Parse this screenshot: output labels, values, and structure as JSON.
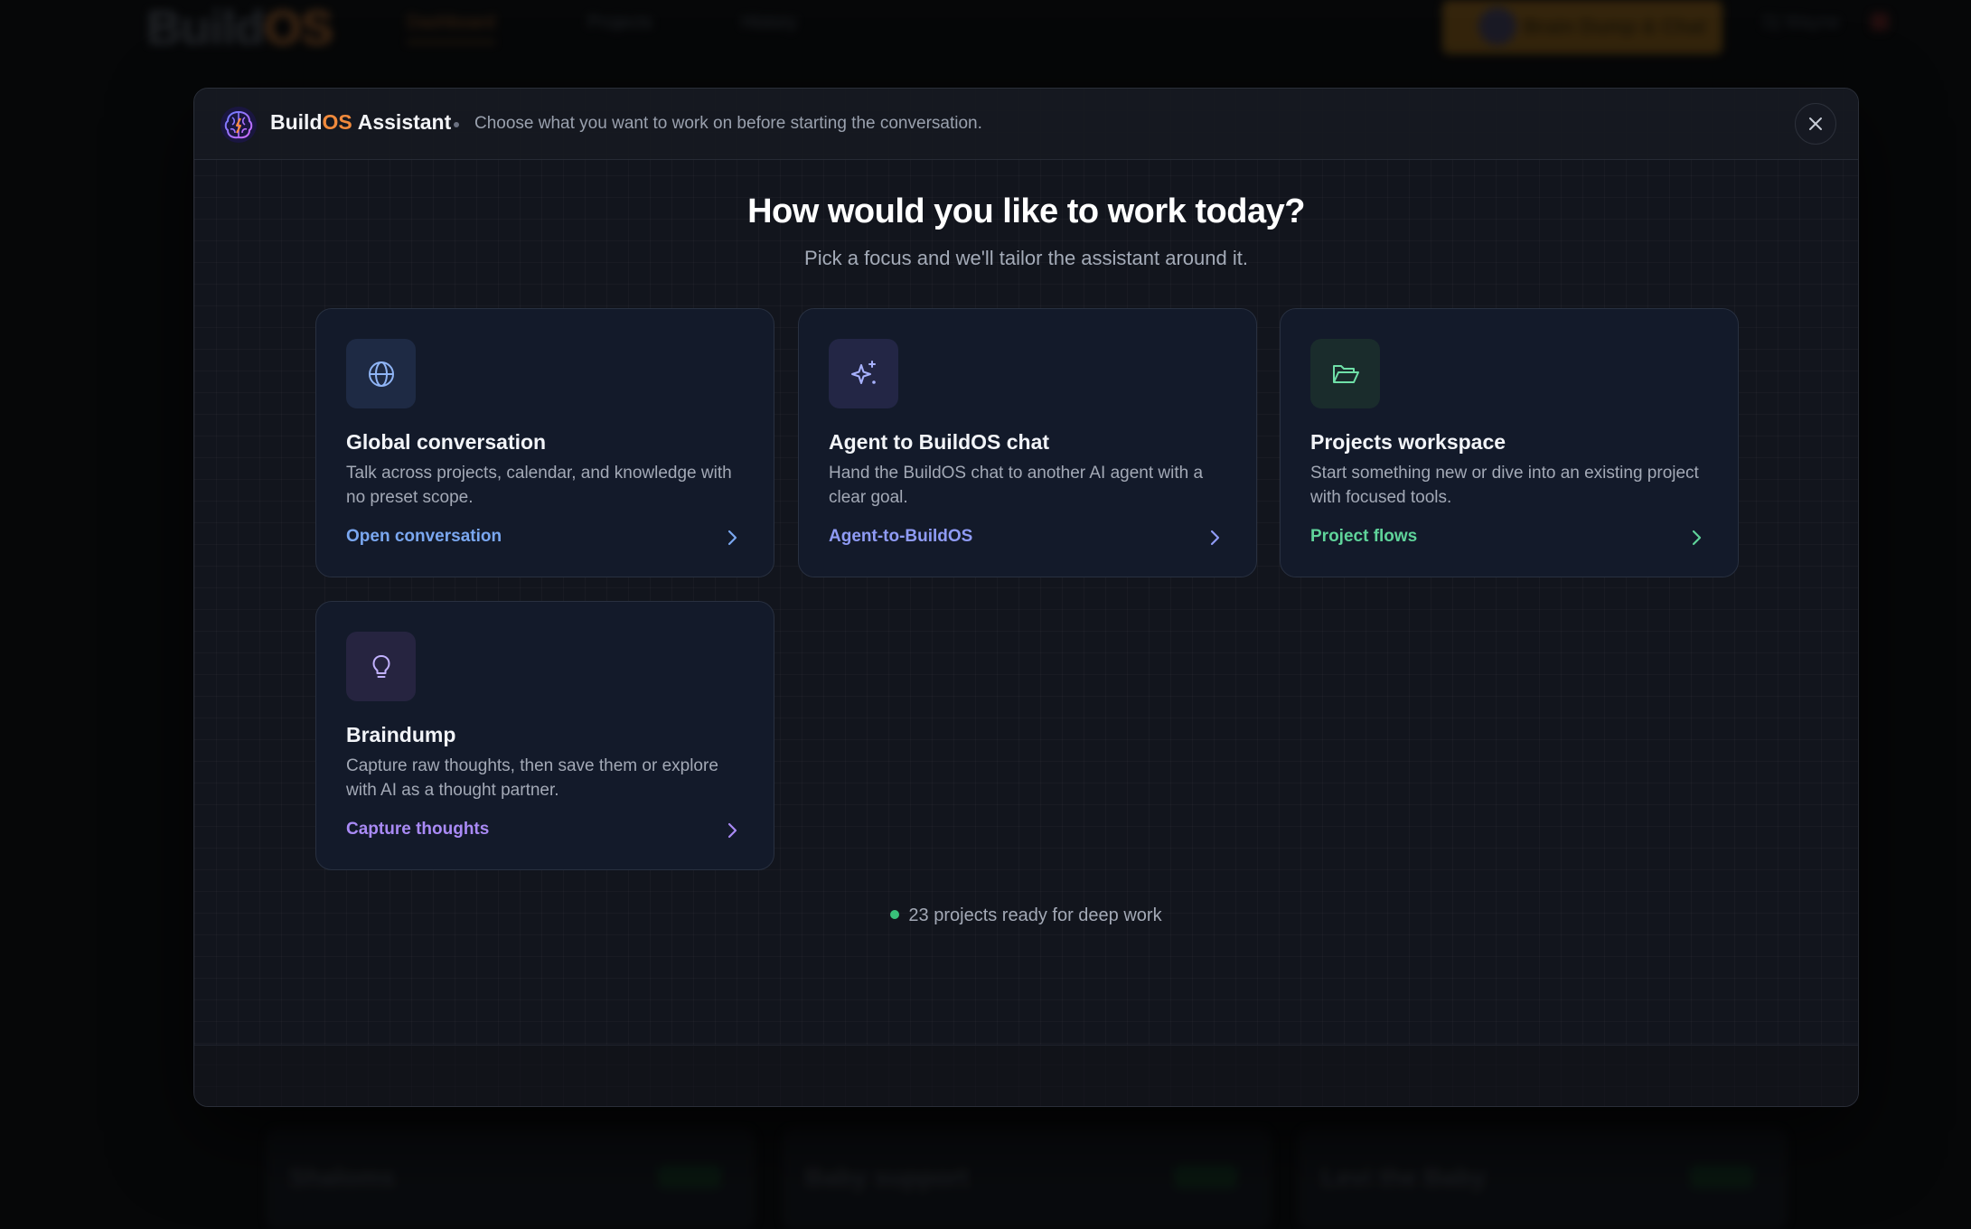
{
  "background": {
    "logo_build": "Build",
    "logo_os": "OS",
    "nav_items": [
      "Dashboard",
      "Projects",
      "History"
    ],
    "cta_label": "Brain Dump & Chat",
    "user_label": "Dj Wayne",
    "cards": [
      {
        "title": "Shaloms",
        "badge": "Active"
      },
      {
        "title": "Baby support",
        "badge": "Active"
      },
      {
        "title": "Levi the Baby",
        "badge": "Active"
      }
    ]
  },
  "modal": {
    "brand_build": "Build",
    "brand_os": "OS",
    "brand_assistant": "Assistant",
    "header_subtitle": "Choose what you want to work on before starting the conversation.",
    "close_icon": "close-icon",
    "title": "How would you like to work today?",
    "subtitle": "Pick a focus and we'll tailor the assistant around it.",
    "options": [
      {
        "icon": "globe-icon",
        "title": "Global conversation",
        "description": "Talk across projects, calendar, and knowledge with no preset scope.",
        "link": "Open conversation",
        "accent": "#7aa7f0"
      },
      {
        "icon": "sparkles-icon",
        "title": "Agent to BuildOS chat",
        "description": "Hand the BuildOS chat to another AI agent with a clear goal.",
        "link": "Agent-to-BuildOS",
        "accent": "#8f9bf5"
      },
      {
        "icon": "folder-open-icon",
        "title": "Projects workspace",
        "description": "Start something new or dive into an existing project with focused tools.",
        "link": "Project flows",
        "accent": "#5fd39a"
      },
      {
        "icon": "lightbulb-icon",
        "title": "Braindump",
        "description": "Capture raw thoughts, then save them or explore with AI as a thought partner.",
        "link": "Capture thoughts",
        "accent": "#a98af5"
      }
    ],
    "status": "23 projects ready for deep work",
    "status_color": "#39c07a"
  }
}
